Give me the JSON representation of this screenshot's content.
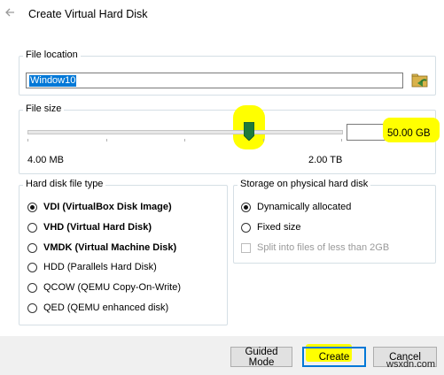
{
  "window": {
    "title": "Create Virtual Hard Disk"
  },
  "file_location": {
    "label": "File location",
    "value": "Window10"
  },
  "file_size": {
    "label": "File size",
    "value": "50.00 GB",
    "min_label": "4.00 MB",
    "max_label": "2.00 TB",
    "slider_position_fraction": 0.7
  },
  "disk_type": {
    "label": "Hard disk file type",
    "options": [
      {
        "label": "VDI (VirtualBox Disk Image)",
        "selected": true,
        "bold": true
      },
      {
        "label": "VHD (Virtual Hard Disk)",
        "selected": false,
        "bold": true
      },
      {
        "label": "VMDK (Virtual Machine Disk)",
        "selected": false,
        "bold": true
      },
      {
        "label": "HDD (Parallels Hard Disk)",
        "selected": false,
        "bold": false
      },
      {
        "label": "QCOW (QEMU Copy-On-Write)",
        "selected": false,
        "bold": false
      },
      {
        "label": "QED (QEMU enhanced disk)",
        "selected": false,
        "bold": false
      }
    ]
  },
  "storage": {
    "label": "Storage on physical hard disk",
    "dynamic": "Dynamically allocated",
    "fixed": "Fixed size",
    "split": "Split into files of less than 2GB"
  },
  "buttons": {
    "guided": "Guided Mode",
    "create": "Create",
    "cancel": "Cancel"
  },
  "watermark": "wsxdn.com",
  "colors": {
    "highlight": "#ffff00",
    "selection": "#0078d7",
    "thumb": "#1e7a3c"
  },
  "icons": {
    "back": "back-arrow-icon",
    "folder": "folder-icon"
  }
}
